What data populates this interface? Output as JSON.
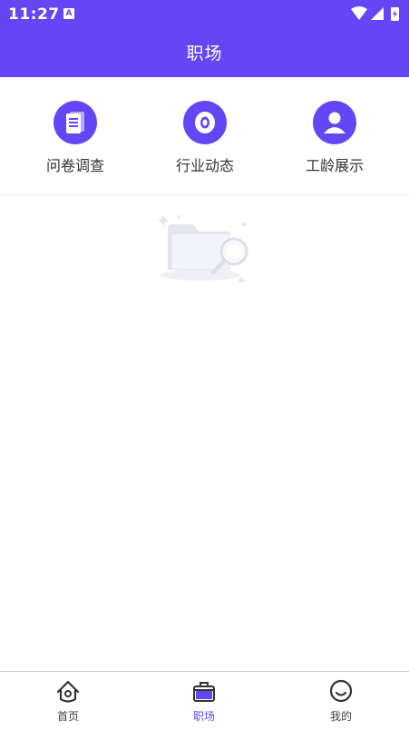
{
  "status_bar": {
    "time": "11:27",
    "notification_icon": "A"
  },
  "header": {
    "title": "职场"
  },
  "menu": {
    "items": [
      {
        "label": "问卷调查",
        "icon": "survey-document-icon"
      },
      {
        "label": "行业动态",
        "icon": "eye-icon"
      },
      {
        "label": "工龄展示",
        "icon": "user-icon"
      }
    ]
  },
  "empty_state": {
    "icon": "empty-folder-search-icon"
  },
  "bottom_nav": {
    "items": [
      {
        "label": "首页",
        "icon": "home-icon",
        "active": false
      },
      {
        "label": "职场",
        "icon": "briefcase-icon",
        "active": true
      },
      {
        "label": "我的",
        "icon": "smile-icon",
        "active": false
      }
    ]
  },
  "colors": {
    "primary": "#6446f5",
    "text": "#333333",
    "inactive_nav": "#444444"
  }
}
